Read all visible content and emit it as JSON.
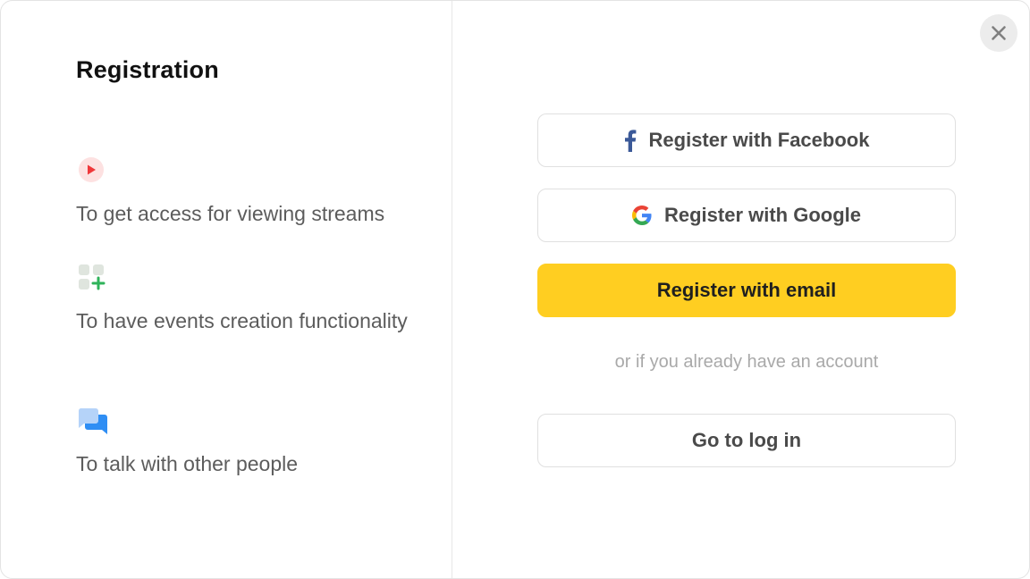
{
  "title": "Registration",
  "features": [
    {
      "icon": "play-stream-icon",
      "text": "To get access for viewing streams"
    },
    {
      "icon": "add-grid-icon",
      "text": "To have events creation functionality"
    },
    {
      "icon": "chat-bubbles-icon",
      "text": "To talk with other people"
    }
  ],
  "buttons": {
    "facebook": "Register with Facebook",
    "google": "Register with Google",
    "email": "Register with email",
    "login": "Go to log in"
  },
  "divider_text": "or if you already have an account",
  "colors": {
    "accent_yellow": "#ffce21",
    "facebook_blue": "#3b5998",
    "play_red": "#f0373a",
    "add_green": "#2fb35a",
    "chat_blue": "#2f8ef4"
  }
}
